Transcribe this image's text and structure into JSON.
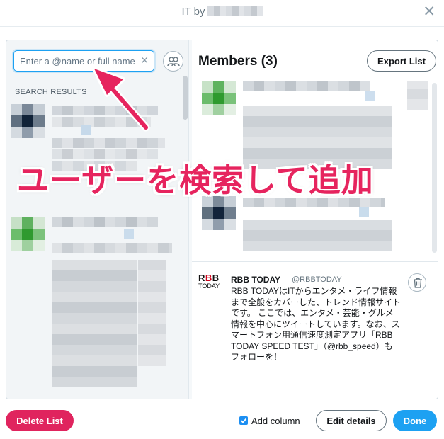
{
  "dialog": {
    "title": "IT by",
    "close_icon": "close-icon"
  },
  "left_panel": {
    "search": {
      "value": "",
      "placeholder": "Enter a @name or full name"
    },
    "search_results_label": "SEARCH RESULTS"
  },
  "right_panel": {
    "members_title": "Members (3)",
    "export_label": "Export List",
    "featured_member": {
      "logo_line1_part1": "R",
      "logo_line1_part2": "B",
      "logo_line1_part3": "B",
      "logo_line2": "TODAY",
      "name": "RBB TODAY",
      "handle": "@RBBTODAY",
      "bio": "RBB TODAYはITからエンタメ・ライフ情報まで全般をカバーした、トレンド情報サイトです。 ここでは、エンタメ・芸能・グルメ情報を中心にツイートしています。なお、スマートフォン用通信速度測定アプリ「RBB TODAY SPEED TEST」（@rbb_speed）もフォローを！"
    }
  },
  "overlay": {
    "annotation_text": "ユーザーを検索して追加"
  },
  "footer": {
    "delete_label": "Delete List",
    "add_column_label": "Add column",
    "add_column_checked": true,
    "edit_label": "Edit details",
    "done_label": "Done"
  },
  "colors": {
    "accent": "#1da1f2",
    "danger": "#e0245e",
    "annotation": "#e6245e"
  }
}
